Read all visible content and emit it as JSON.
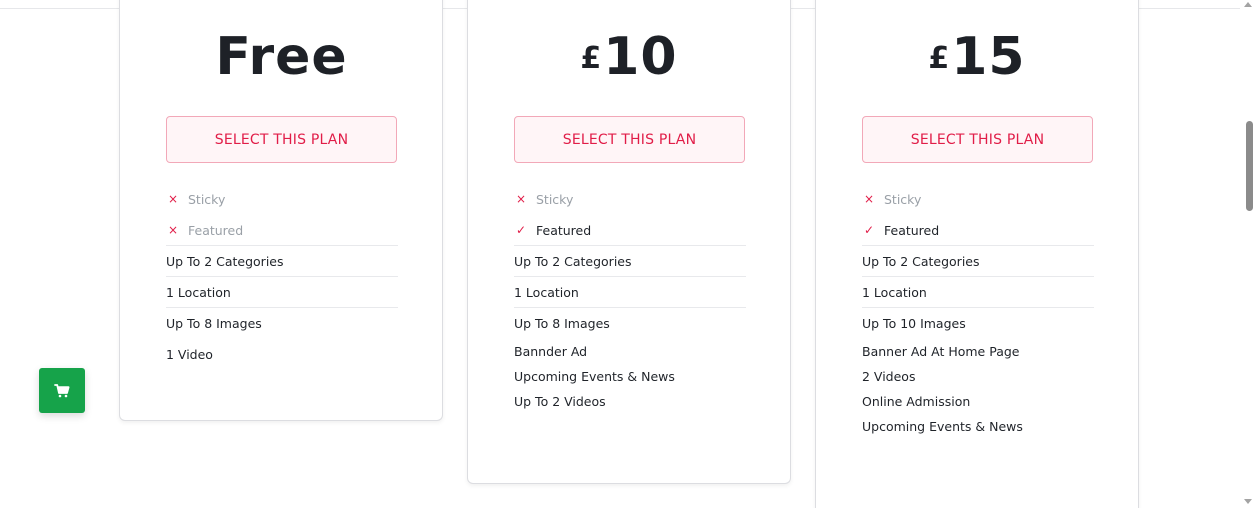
{
  "plans": [
    {
      "price_currency": "",
      "price_amount": "Free",
      "button_label": "SELECT THIS PLAN",
      "features": [
        {
          "mark": "×",
          "label": "Sticky",
          "available": false
        },
        {
          "mark": "×",
          "label": "Featured",
          "available": false
        },
        {
          "mark": "",
          "label": "Up To 2 Categories",
          "available": true
        },
        {
          "mark": "",
          "label": "1 Location",
          "available": true
        },
        {
          "mark": "",
          "label": "Up To 8 Images",
          "available": true
        },
        {
          "mark": "",
          "label": "1 Video",
          "available": true
        }
      ]
    },
    {
      "price_currency": "£",
      "price_amount": "10",
      "button_label": "SELECT THIS PLAN",
      "features": [
        {
          "mark": "×",
          "label": "Sticky",
          "available": false
        },
        {
          "mark": "✓",
          "label": "Featured",
          "available": true
        },
        {
          "mark": "",
          "label": "Up To 2 Categories",
          "available": true
        },
        {
          "mark": "",
          "label": "1 Location",
          "available": true
        },
        {
          "mark": "",
          "label": "Up To 8 Images",
          "available": true
        },
        {
          "mark": "",
          "label": "Bannder Ad",
          "available": true
        },
        {
          "mark": "",
          "label": "Upcoming Events & News",
          "available": true
        },
        {
          "mark": "",
          "label": "Up To 2 Videos",
          "available": true
        }
      ]
    },
    {
      "price_currency": "£",
      "price_amount": "15",
      "button_label": "SELECT THIS PLAN",
      "features": [
        {
          "mark": "×",
          "label": "Sticky",
          "available": false
        },
        {
          "mark": "✓",
          "label": "Featured",
          "available": true
        },
        {
          "mark": "",
          "label": "Up To 2 Categories",
          "available": true
        },
        {
          "mark": "",
          "label": "1 Location",
          "available": true
        },
        {
          "mark": "",
          "label": "Up To 10 Images",
          "available": true
        },
        {
          "mark": "",
          "label": "Banner Ad At Home Page",
          "available": true
        },
        {
          "mark": "",
          "label": "2 Videos",
          "available": true
        },
        {
          "mark": "",
          "label": "Online Admission",
          "available": true
        },
        {
          "mark": "",
          "label": "Upcoming Events & News",
          "available": true
        }
      ]
    }
  ],
  "cart_button": {
    "icon": "cart-icon"
  },
  "colors": {
    "accent": "#e11d48",
    "button_bg": "#fff5f7",
    "button_border": "#f2a8b8",
    "cart_green": "#16a34a",
    "muted_text": "#9aa0a7"
  }
}
